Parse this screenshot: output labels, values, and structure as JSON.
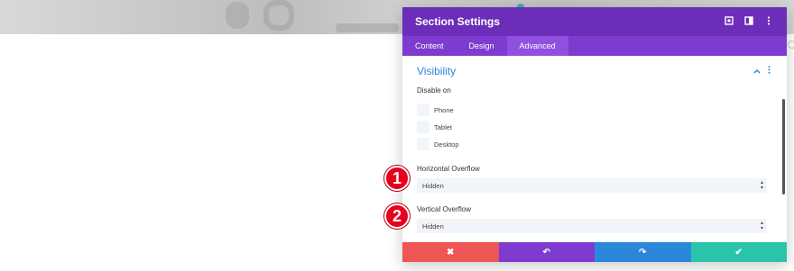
{
  "modal": {
    "title": "Section Settings",
    "tabs": [
      {
        "label": "Content"
      },
      {
        "label": "Design"
      },
      {
        "label": "Advanced"
      }
    ],
    "section_title": "Visibility",
    "disable_on_label": "Disable on",
    "devices": [
      {
        "label": "Phone"
      },
      {
        "label": "Tablet"
      },
      {
        "label": "Desktop"
      }
    ],
    "horizontal_overflow": {
      "label": "Horizontal Overflow",
      "value": "Hidden"
    },
    "vertical_overflow": {
      "label": "Vertical Overflow",
      "value": "Hidden"
    },
    "footer": {
      "cancel_icon": "✖",
      "undo_icon": "↶",
      "redo_icon": "↷",
      "save_icon": "✔"
    }
  },
  "callouts": [
    "1",
    "2"
  ],
  "icons": {
    "header": [
      "fullscreen-icon",
      "split-view-icon",
      "more-icon"
    ],
    "section": [
      "chevron-up-icon",
      "more-icon"
    ]
  },
  "colors": {
    "header": "#6c2eb9",
    "tabs": "#7e3bd0",
    "accent": "#2b87da",
    "cancel": "#ef5555",
    "save": "#29c4a9",
    "callout": "#e8001c"
  }
}
